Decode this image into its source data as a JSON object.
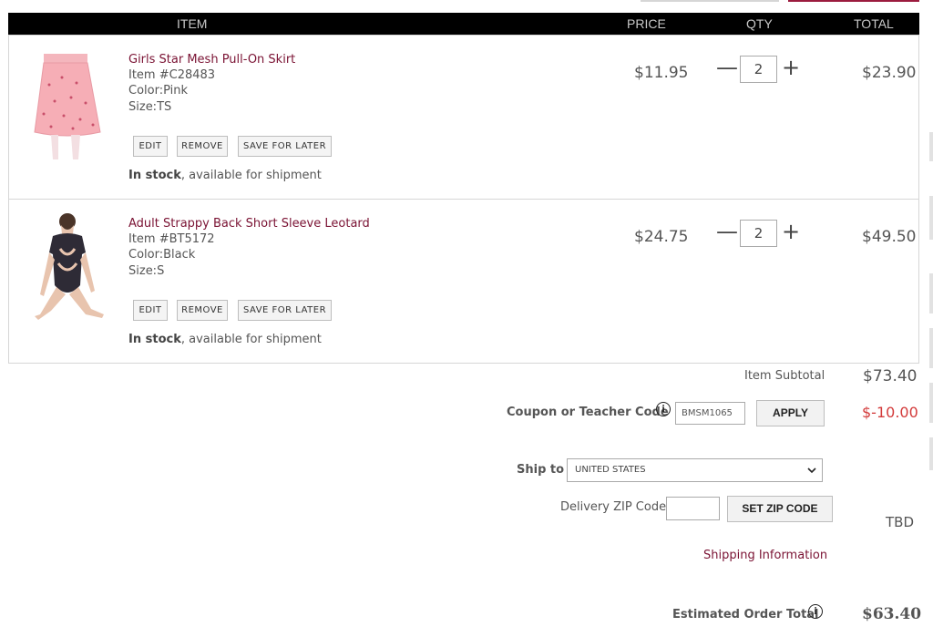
{
  "header": {
    "item": "ITEM",
    "price": "PRICE",
    "qty": "QTY",
    "total": "TOTAL"
  },
  "items": [
    {
      "name": "Girls Star Mesh Pull-On Skirt",
      "item_no": "Item #C28483",
      "color": "Color:Pink",
      "size": "Size:TS",
      "price": "$11.95",
      "qty": "2",
      "total": "$23.90",
      "stock_bold": "In stock",
      "stock_rest": ", available for shipment",
      "image": "pink-sparkle-skirt"
    },
    {
      "name": "Adult Strappy Back Short Sleeve Leotard",
      "item_no": "Item #BT5172",
      "color": "Color:Black",
      "size": "Size:S",
      "price": "$24.75",
      "qty": "2",
      "total": "$49.50",
      "stock_bold": "In stock",
      "stock_rest": ", available for shipment",
      "image": "black-strappy-leotard"
    }
  ],
  "actions": {
    "edit": "EDIT",
    "remove": "REMOVE",
    "save": "SAVE FOR LATER"
  },
  "qty_controls": {
    "minus": "—",
    "plus": "+"
  },
  "summary": {
    "subtotal_label": "Item Subtotal",
    "subtotal": "$73.40",
    "coupon_label": "Coupon or Teacher Code",
    "coupon_value": "BMSM1065",
    "apply": "APPLY",
    "discount": "$-10.00",
    "ship_to_label": "Ship to",
    "country": "UNITED STATES",
    "zip_label": "Delivery ZIP Code",
    "set_zip": "SET ZIP CODE",
    "shipping_cost": "TBD",
    "shipping_info": "Shipping Information",
    "estimated_label": "Estimated Order Total",
    "estimated_total": "$63.40"
  },
  "icons": {
    "info": "info-icon",
    "chevron": "chevron-down-icon"
  },
  "colors": {
    "header_bg": "#000000",
    "link": "#7a1233",
    "discount": "#d33a3a"
  }
}
